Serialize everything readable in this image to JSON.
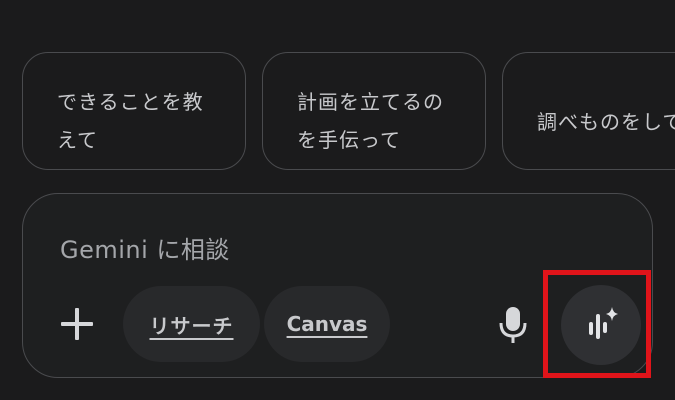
{
  "suggestions": [
    {
      "label": "できることを教\nえて"
    },
    {
      "label": "計画を立てるの\nを手伝って"
    },
    {
      "label": "調べものをして"
    }
  ],
  "composer": {
    "placeholder": "Gemini に相談",
    "tools": [
      {
        "label": "リサーチ"
      },
      {
        "label": "Canvas"
      }
    ],
    "icons": {
      "add": "plus-icon",
      "mic": "microphone-icon",
      "live": "gemini-live-icon"
    }
  },
  "colors": {
    "background": "#1b1b1c",
    "border": "#4a4b4e",
    "pill": "#28292b",
    "live_button": "#2f3033",
    "highlight": "#e0141a"
  }
}
